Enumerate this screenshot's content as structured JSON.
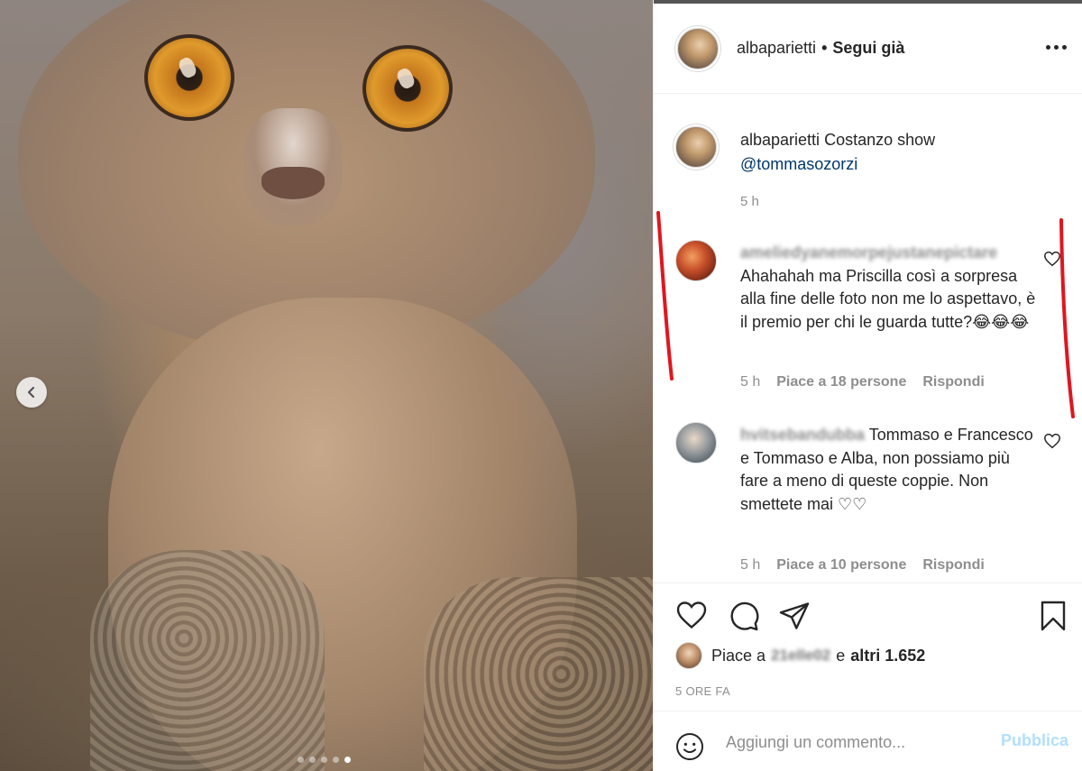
{
  "post": {
    "username": "albaparietti",
    "follow_dot": "•",
    "follow_state": "Segui già"
  },
  "caption": {
    "username": "albaparietti",
    "text": "Costanzo show",
    "mention": "@tommasozorzi",
    "time": "5 h"
  },
  "comments": [
    {
      "username": "ameliedyanemorpejustanepictare",
      "text": "Ahahahah ma Priscilla così a sorpresa alla fine delle foto non me lo aspettavo, è il premio per chi le guarda tutte?😂😂😂",
      "time": "5 h",
      "likes": "Piace a 18 persone",
      "reply": "Rispondi"
    },
    {
      "username": "hvitsebandubba",
      "text": "Tommaso e Francesco e Tommaso e Alba, non possiamo più fare a meno di queste coppie. Non smettete mai ♡♡",
      "time": "5 h",
      "likes": "Piace a 10 persone",
      "reply": "Rispondi"
    }
  ],
  "likes": {
    "prefix": "Piace a",
    "user": "21elle02",
    "conj": "e",
    "others": "altri 1.652"
  },
  "timestamp": "5 ORE FA",
  "comment_box": {
    "placeholder": "Aggiungi un commento...",
    "post_label": "Pubblica"
  },
  "carousel": {
    "total": 5,
    "active": 5
  },
  "icons": {
    "more": "more-options-icon",
    "like": "heart-icon",
    "comment": "comment-bubble-icon",
    "share": "paper-plane-icon",
    "save": "bookmark-icon",
    "emoji": "smiley-icon",
    "prev": "chevron-left-icon"
  },
  "colors": {
    "link": "#00376b",
    "muted": "#8e8e8e",
    "post_disabled": "#b2dffc",
    "annotation": "#e0161f"
  }
}
